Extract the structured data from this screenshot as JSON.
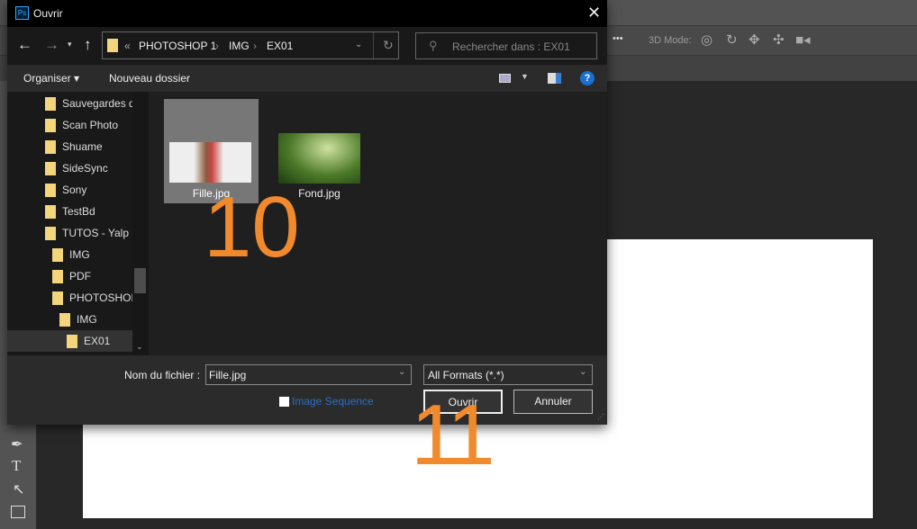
{
  "ps": {
    "mode_label": "3D Mode:",
    "more": "•••",
    "icons": [
      "orbit-icon",
      "roll-icon",
      "pan-icon",
      "slide-icon",
      "camera-icon"
    ]
  },
  "dialog": {
    "app_badge": "Ps",
    "title": "Ouvrir",
    "path": [
      "PHOTOSHOP 1",
      "IMG",
      "EX01"
    ],
    "path_prefix": "«",
    "search_placeholder": "Rechercher dans : EX01",
    "organise": "Organiser ▾",
    "new_folder": "Nouveau dossier",
    "tree": [
      {
        "label": "Sauvegardes de",
        "level": 0
      },
      {
        "label": "Scan Photo",
        "level": 0
      },
      {
        "label": "Shuame",
        "level": 0
      },
      {
        "label": "SideSync",
        "level": 0
      },
      {
        "label": "Sony",
        "level": 0
      },
      {
        "label": "TestBd",
        "level": 0
      },
      {
        "label": "TUTOS - Yalp",
        "level": 0
      },
      {
        "label": "IMG",
        "level": 1
      },
      {
        "label": "PDF",
        "level": 1
      },
      {
        "label": "PHOTOSHOP",
        "level": 1
      },
      {
        "label": "IMG",
        "level": 2
      },
      {
        "label": "EX01",
        "level": 3,
        "selected": true
      }
    ],
    "files": [
      {
        "name": "Fille.jpg",
        "selected": true
      },
      {
        "name": "Fond.jpg"
      }
    ],
    "filename_label": "Nom du fichier :",
    "filename_value": "Fille.jpg",
    "filetype": "All Formats (*.*)",
    "image_sequence": "Image Sequence",
    "open": "Ouvrir",
    "cancel": "Annuler"
  },
  "annotations": {
    "step1": "10",
    "step2": "11",
    "color": "#f08a2c"
  }
}
